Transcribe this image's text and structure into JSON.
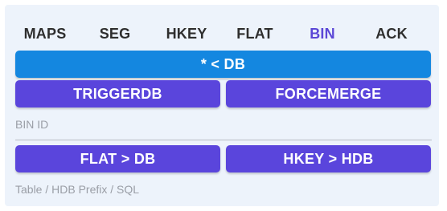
{
  "tabs": [
    {
      "label": "MAPS",
      "active": false
    },
    {
      "label": "SEG",
      "active": false
    },
    {
      "label": "HKEY",
      "active": false
    },
    {
      "label": "FLAT",
      "active": false
    },
    {
      "label": "BIN",
      "active": true
    },
    {
      "label": "ACK",
      "active": false
    }
  ],
  "buttons": {
    "all_to_db": "* < DB",
    "triggerdb": "TRIGGERDB",
    "forcemerge": "FORCEMERGE",
    "flat_to_db": "FLAT > DB",
    "hkey_to_hdb": "HKEY > HDB"
  },
  "captions": {
    "bin_id": "BIN ID",
    "table_prefix": "Table / HDB Prefix / SQL"
  },
  "colors": {
    "panel_bg": "#edf3fb",
    "active_tab": "#5b47d6",
    "primary_blue": "#1487e0",
    "action_purple": "#5a45dc",
    "caption_gray": "#9a9ea6"
  }
}
